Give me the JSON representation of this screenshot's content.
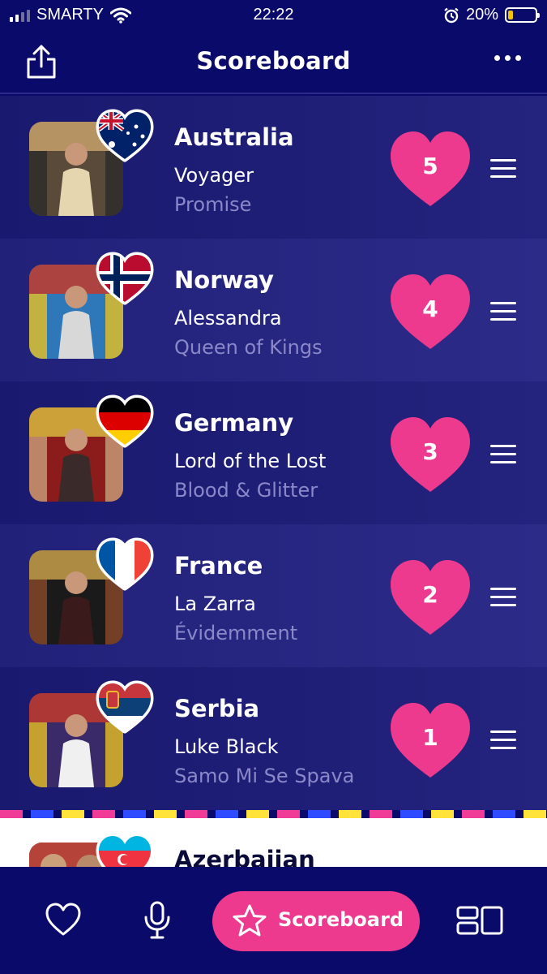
{
  "status_bar": {
    "carrier": "SMARTY",
    "time": "22:22",
    "battery_percent": "20%",
    "battery_level": 0.2,
    "signal_bars": 2
  },
  "header": {
    "title": "Scoreboard",
    "share_icon": "share-icon",
    "more_icon": "more-icon"
  },
  "entries": [
    {
      "country": "Australia",
      "artist": "Voyager",
      "song": "Promise",
      "points": "5",
      "flag": "au"
    },
    {
      "country": "Norway",
      "artist": "Alessandra",
      "song": "Queen of Kings",
      "points": "4",
      "flag": "no"
    },
    {
      "country": "Germany",
      "artist": "Lord of the Lost",
      "song": "Blood & Glitter",
      "points": "3",
      "flag": "de"
    },
    {
      "country": "France",
      "artist": "La Zarra",
      "song": "Évidemment",
      "points": "2",
      "flag": "fr"
    },
    {
      "country": "Serbia",
      "artist": "Luke Black",
      "song": "Samo Mi Se Spava",
      "points": "1",
      "flag": "rs"
    }
  ],
  "peek_entry": {
    "country": "Azerbaijan",
    "flag": "az"
  },
  "bottom_nav": {
    "active_label": "Scoreboard",
    "items": [
      "heart-icon",
      "microphone-icon",
      "star-icon",
      "layout-icon"
    ]
  },
  "colors": {
    "background": "#0a0a6b",
    "accent_pink": "#ee3a8e",
    "muted_text": "#8a88c8"
  }
}
